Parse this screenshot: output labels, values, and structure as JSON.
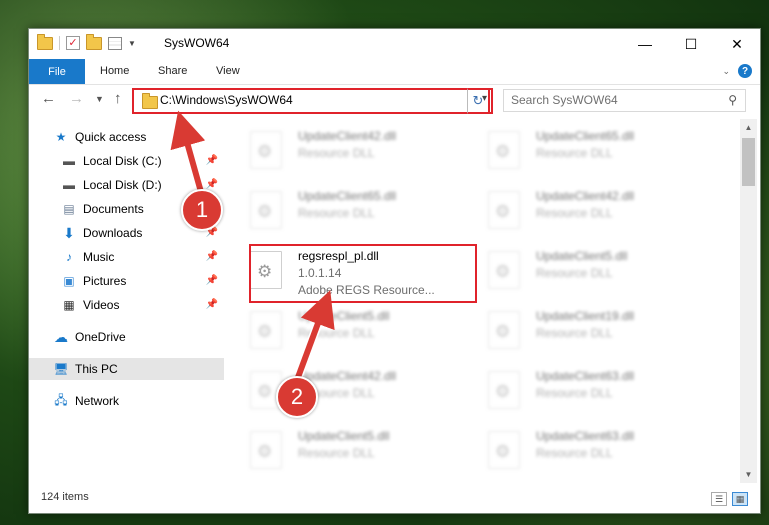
{
  "window": {
    "title": "SysWOW64",
    "controls": {
      "minimize": "—",
      "maximize": "☐",
      "close": "✕"
    }
  },
  "ribbon": {
    "file": "File",
    "tabs": [
      "Home",
      "Share",
      "View"
    ],
    "help": "?"
  },
  "address": {
    "path": "C:\\Windows\\SysWOW64",
    "search_placeholder": "Search SysWOW64"
  },
  "nav": {
    "quick_access": "Quick access",
    "items": [
      {
        "label": "Local Disk (C:)",
        "icon": "drive-icon",
        "pinned": true
      },
      {
        "label": "Local Disk (D:)",
        "icon": "drive-icon",
        "pinned": true
      },
      {
        "label": "Documents",
        "icon": "documents-icon",
        "pinned": true
      },
      {
        "label": "Downloads",
        "icon": "downloads-icon",
        "pinned": true
      },
      {
        "label": "Music",
        "icon": "music-icon",
        "pinned": true
      },
      {
        "label": "Pictures",
        "icon": "pictures-icon",
        "pinned": true
      },
      {
        "label": "Videos",
        "icon": "videos-icon",
        "pinned": true
      }
    ],
    "onedrive": "OneDrive",
    "this_pc": "This PC",
    "network": "Network"
  },
  "files": {
    "left": [
      {
        "name": "UpdateClient42.dll",
        "sub": "Resource DLL"
      },
      {
        "name": "UpdateClient65.dll",
        "sub": "Resource DLL"
      },
      {
        "name": "regsrespl_pl.dll",
        "sub": "1.0.1.14",
        "sub2": "Adobe REGS Resource..."
      },
      {
        "name": "UpdateClient5.dll",
        "sub": "Resource DLL"
      },
      {
        "name": "UpdateClient42.dll",
        "sub": "Resource DLL"
      },
      {
        "name": "UpdateClient5.dll",
        "sub": "Resource DLL"
      }
    ],
    "right": [
      {
        "name": "UpdateClient65.dll",
        "sub": "Resource DLL"
      },
      {
        "name": "UpdateClient42.dll",
        "sub": "Resource DLL"
      },
      {
        "name": "UpdateClient5.dll",
        "sub": "Resource DLL"
      },
      {
        "name": "UpdateClient19.dll",
        "sub": "Resource DLL"
      },
      {
        "name": "UpdateClient63.dll",
        "sub": "Resource DLL"
      },
      {
        "name": "UpdateClient63.dll",
        "sub": "Resource DLL"
      }
    ]
  },
  "status": {
    "items": "124 items"
  },
  "annotations": {
    "badge1": "1",
    "badge2": "2",
    "color": "#d93a33"
  }
}
